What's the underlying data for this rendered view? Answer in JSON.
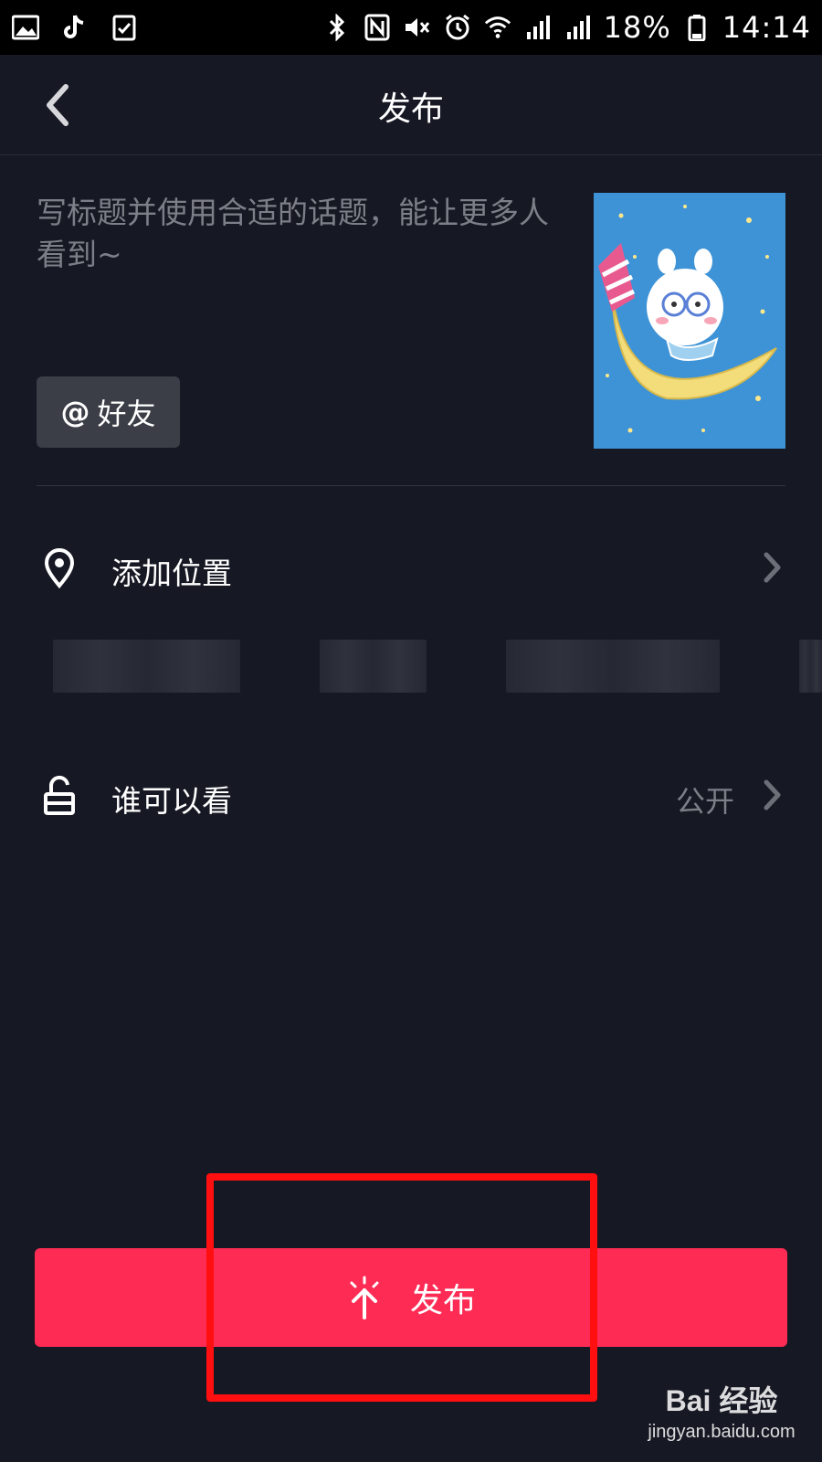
{
  "status_bar": {
    "battery": "18%",
    "time": "14:14",
    "left_icons": [
      "gallery-icon",
      "tiktok-icon",
      "clipboard-icon"
    ],
    "right_icons": [
      "bluetooth-icon",
      "nfc-icon",
      "mute-icon",
      "alarm-icon",
      "wifi-icon",
      "signal-icon",
      "signal-4g-icon",
      "battery-icon"
    ]
  },
  "header": {
    "title": "发布"
  },
  "caption": {
    "placeholder": "写标题并使用合适的话题，能让更多人看到~"
  },
  "mention_button": {
    "symbol": "@",
    "label": "好友"
  },
  "settings": {
    "location": {
      "label": "添加位置",
      "icon": "location-pin-icon"
    },
    "privacy": {
      "label": "谁可以看",
      "value": "公开",
      "icon": "unlock-icon"
    }
  },
  "publish_button": {
    "label": "发布",
    "icon": "upload-icon"
  },
  "watermark": {
    "logo": "Bai 经验",
    "url": "jingyan.baidu.com"
  },
  "colors": {
    "background": "#161823",
    "accent": "#fe2c55",
    "highlight_box": "#ff0f0f",
    "muted_text": "#7d7f88"
  }
}
